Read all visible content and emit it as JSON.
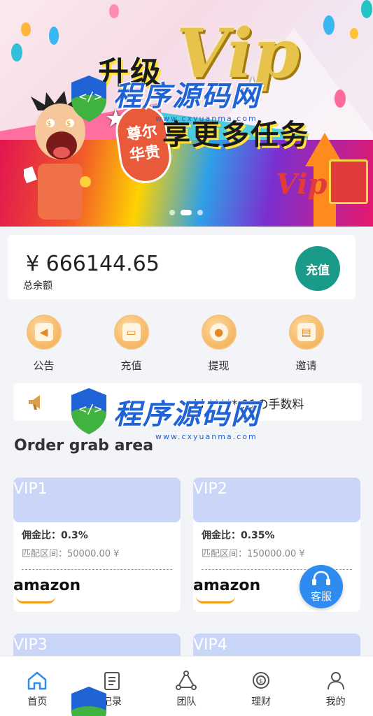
{
  "banner": {
    "headline": "升级",
    "vip_text": "Vip",
    "subline": "享更多任务",
    "badge_line1": "尊尔",
    "badge_line2": "华贵",
    "corner_vip": "Vip"
  },
  "watermark": {
    "name": "程序源码网",
    "url": "www.cxyuanma.com"
  },
  "balance": {
    "amount": "¥ 666144.65",
    "label": "总余额",
    "recharge_button": "充值"
  },
  "actions": [
    {
      "label": "公告",
      "icon": "megaphone-icon"
    },
    {
      "label": "充值",
      "icon": "wallet-icon"
    },
    {
      "label": "提现",
      "icon": "coin-icon"
    },
    {
      "label": "邀请",
      "icon": "atm-icon"
    }
  ],
  "notice": {
    "message": "kj ***** 91の手数料"
  },
  "section": {
    "title": "Order grab area"
  },
  "vip_cards": [
    {
      "name": "VIP1",
      "rate": "佣金比：0.3%",
      "range": "匹配区间：50000.00 ¥",
      "brand": "amazon"
    },
    {
      "name": "VIP2",
      "rate": "佣金比：0.35%",
      "range": "匹配区间：150000.00 ¥",
      "brand": "amazon"
    },
    {
      "name": "VIP3"
    },
    {
      "name": "VIP4"
    }
  ],
  "customer_service": {
    "label": "客服"
  },
  "tabbar": [
    {
      "label": "首页",
      "icon": "home-icon",
      "active": true
    },
    {
      "label": "记录",
      "icon": "record-icon"
    },
    {
      "label": "团队",
      "icon": "team-icon"
    },
    {
      "label": "理财",
      "icon": "finance-icon"
    },
    {
      "label": "我的",
      "icon": "profile-icon"
    }
  ],
  "colors": {
    "accent_green": "#1a9b8a",
    "accent_blue": "#2e8cf0",
    "vip_header": "#c9d6f8",
    "active_tab": "#2e8cf0"
  }
}
